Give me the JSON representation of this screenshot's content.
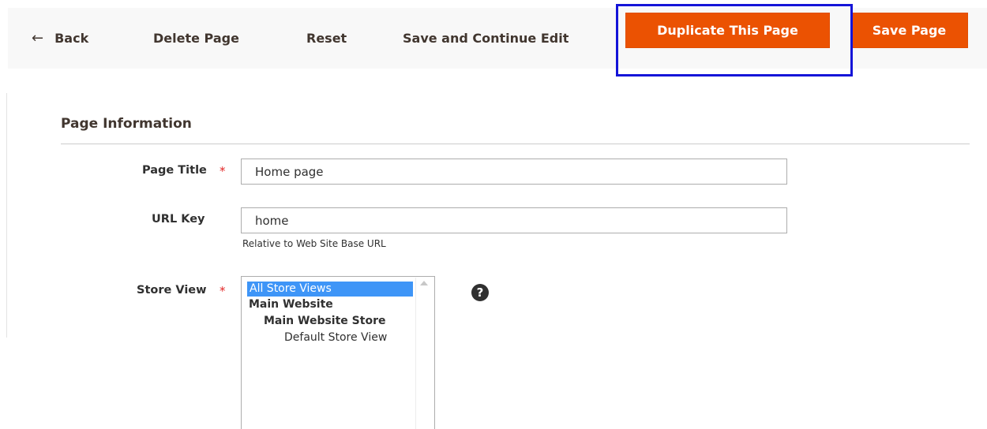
{
  "toolbar": {
    "back_arrow": "←",
    "back_label": "Back",
    "delete_label": "Delete Page",
    "reset_label": "Reset",
    "save_continue_label": "Save and Continue Edit",
    "duplicate_label": "Duplicate This Page",
    "save_label": "Save Page"
  },
  "section": {
    "title": "Page Information"
  },
  "fields": {
    "page_title": {
      "label": "Page Title",
      "required_mark": "*",
      "value": "Home page"
    },
    "url_key": {
      "label": "URL Key",
      "value": "home",
      "note": "Relative to Web Site Base URL"
    },
    "store_view": {
      "label": "Store View",
      "required_mark": "*",
      "options": [
        "All Store Views",
        "Main Website",
        "Main Website Store",
        "Default Store View"
      ],
      "selected": "All Store Views",
      "help_glyph": "?"
    }
  },
  "colors": {
    "primary_button": "#eb5202",
    "highlight_box": "#1414d8",
    "selection": "#3e95f7",
    "required": "#e22626"
  }
}
